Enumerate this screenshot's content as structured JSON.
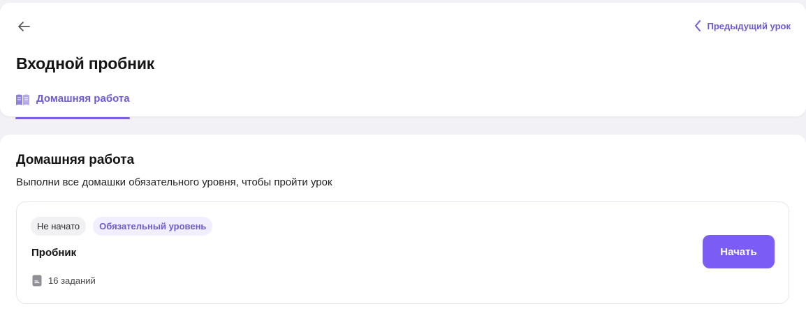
{
  "header": {
    "back_icon": "arrow-left-icon",
    "prev_lesson_label": "Предыдущий урок",
    "prev_icon": "chevron-left-icon",
    "title": "Входной пробник"
  },
  "tabs": [
    {
      "label": "Домашняя работа",
      "icon": "book-icon",
      "active": true
    }
  ],
  "homework": {
    "title": "Домашняя работа",
    "subtitle": "Выполни все домашки обязательного уровня, чтобы пройти урок",
    "items": [
      {
        "status": "Не начато",
        "level": "Обязательный уровень",
        "name": "Пробник",
        "tasks": "16 заданий",
        "tasks_icon": "document-icon",
        "action_label": "Начать"
      }
    ]
  },
  "colors": {
    "accent": "#6f5ad1",
    "button": "#7b5cf5",
    "background": "#f2f2f6"
  }
}
